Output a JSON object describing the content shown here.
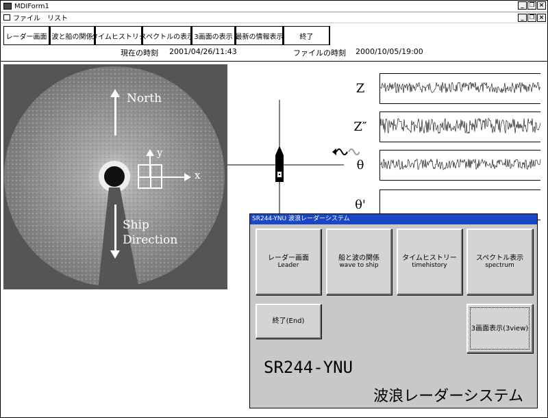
{
  "window": {
    "title": "MDIForm1",
    "controls": [
      "_",
      "❐",
      "×"
    ]
  },
  "menu": {
    "items": [
      "ファイル",
      "リスト"
    ]
  },
  "toolbar": {
    "buttons": [
      "レーダー画面",
      "波と船の関係",
      "タイムヒストリー",
      "スペクトルの表示",
      "3画面の表示",
      "最新の情報表示",
      "終了"
    ]
  },
  "status": {
    "current_time_label": "現在の時刻",
    "current_time_value": "2001/04/26/11:43",
    "file_time_label": "ファイルの時刻",
    "file_time_value": "2000/10/05/19:00"
  },
  "radar": {
    "north_label": "North",
    "ship_label_1": "Ship",
    "ship_label_2": "Direction",
    "axis_x": "x",
    "axis_y": "y"
  },
  "waves": {
    "labels": [
      "Z",
      "Z″",
      "θ",
      "θ'"
    ]
  },
  "dialog": {
    "title": "SR244-YNU 波浪レーダーシステム",
    "buttons": {
      "radar": {
        "line1": "レーダー画面",
        "line2": "Leader"
      },
      "wave_ship": {
        "line1": "船と波の関係",
        "line2": "wave to ship"
      },
      "timehistory": {
        "line1": "タイムヒストリー",
        "line2": "timehistory"
      },
      "spectrum": {
        "line1": "スペクトル表示",
        "line2": "spectrum"
      },
      "end": {
        "line1": "終了(End)"
      },
      "three_view": {
        "line1": "3画面表示(3view)"
      }
    },
    "brand_line1": "SR244-YNU",
    "brand_line2": "波浪レーダーシステム"
  }
}
